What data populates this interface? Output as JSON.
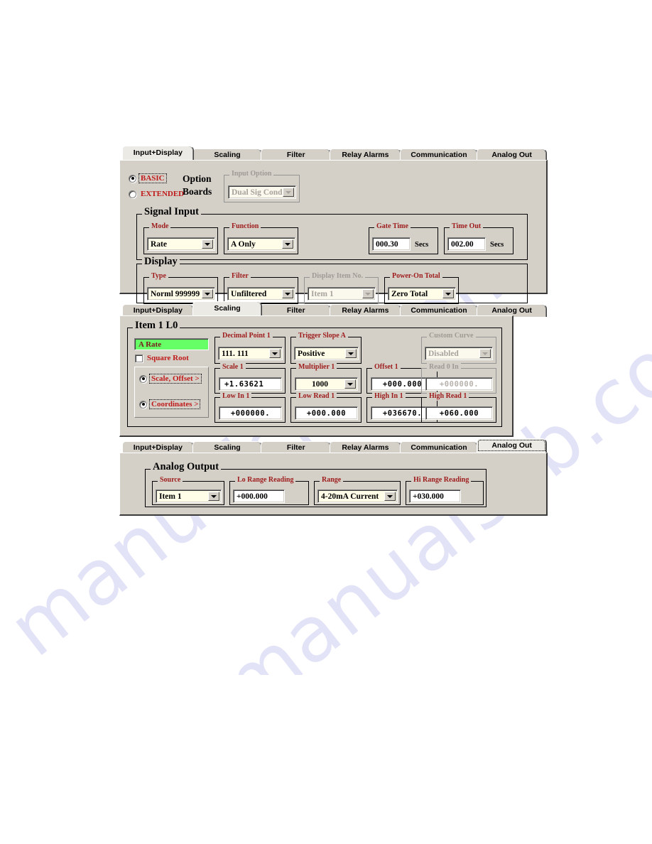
{
  "watermark": {
    "text": "manualslib.com"
  },
  "tabs": [
    "Input+Display",
    "Scaling",
    "Filter",
    "Relay Alarms",
    "Communication",
    "Analog Out"
  ],
  "panel_input_display": {
    "active_tab": "Input+Display",
    "mode_options": {
      "basic_label": "BASIC",
      "extended_label": "EXTENDED",
      "basic_selected": "selected",
      "extended_selected": "unselected"
    },
    "option_boards_label_line1": "Option",
    "option_boards_label_line2": "Boards",
    "input_option": {
      "legend": "Input Option",
      "value": "Dual Sig Cond",
      "state": "disabled"
    },
    "signal_input": {
      "legend": "Signal Input",
      "mode": {
        "legend": "Mode",
        "value": "Rate"
      },
      "function": {
        "legend": "Function",
        "value": "A Only"
      },
      "gate_time": {
        "legend": "Gate Time",
        "value": "000.30",
        "unit": "Secs"
      },
      "time_out": {
        "legend": "Time Out",
        "value": "002.00",
        "unit": "Secs"
      }
    },
    "display": {
      "legend": "Display",
      "type": {
        "legend": "Type",
        "value": "Norml 999999"
      },
      "filter": {
        "legend": "Filter",
        "value": "Unfiltered"
      },
      "display_item_no": {
        "legend": "Display Item No.",
        "value": "Item 1",
        "state": "disabled"
      },
      "power_on_total": {
        "legend": "Power-On Total",
        "value": "Zero Total"
      }
    }
  },
  "panel_scaling": {
    "active_tab": "Scaling",
    "item_group": {
      "legend": "Item 1  L0"
    },
    "a_rate_field": "A Rate",
    "square_root": {
      "label": "Square Root",
      "checked": "unchecked"
    },
    "decimal_point_1": {
      "legend": "Decimal Point 1",
      "value": "111. 111"
    },
    "trigger_slope_a": {
      "legend": "Trigger Slope A",
      "value": "Positive"
    },
    "custom_curve": {
      "legend": "Custom Curve",
      "value": "Disabled",
      "state": "disabled"
    },
    "scale_offset_radio": {
      "label": "Scale, Offset  >",
      "selected": "selected"
    },
    "coordinates_radio": {
      "label": "Coordinates  >",
      "selected": "selected"
    },
    "scale_1": {
      "legend": "Scale 1",
      "value": "+1.63621"
    },
    "multiplier_1": {
      "legend": "Multiplier 1",
      "value": "1000"
    },
    "offset_1": {
      "legend": "Offset 1",
      "value": "+000.000"
    },
    "read_0_in": {
      "legend": "Read 0 In",
      "value": "+000000.",
      "state": "disabled"
    },
    "low_in_1": {
      "legend": "Low In 1",
      "value": "+000000."
    },
    "low_read_1": {
      "legend": "Low Read 1",
      "value": "+000.000"
    },
    "high_in_1": {
      "legend": "High In 1",
      "value": "+036670."
    },
    "high_read_1": {
      "legend": "High Read 1",
      "value": "+060.000"
    }
  },
  "panel_analog_out": {
    "active_tab": "Analog Out",
    "analog_output": {
      "legend": "Analog Output"
    },
    "source": {
      "legend": "Source",
      "value": "Item 1"
    },
    "lo_range_reading": {
      "legend": "Lo Range Reading",
      "value": "+000.000"
    },
    "range": {
      "legend": "Range",
      "value": "4-20mA Current"
    },
    "hi_range_reading": {
      "legend": "Hi Range Reading",
      "value": "+030.000"
    }
  },
  "colors": {
    "legend_red": "#9e1b1b",
    "label_red": "#c01919",
    "face": "#d4d0c8",
    "field_yellow": "#fffde8",
    "green_field": "#66ff66",
    "watermark_blue": "#5a5ad6"
  }
}
